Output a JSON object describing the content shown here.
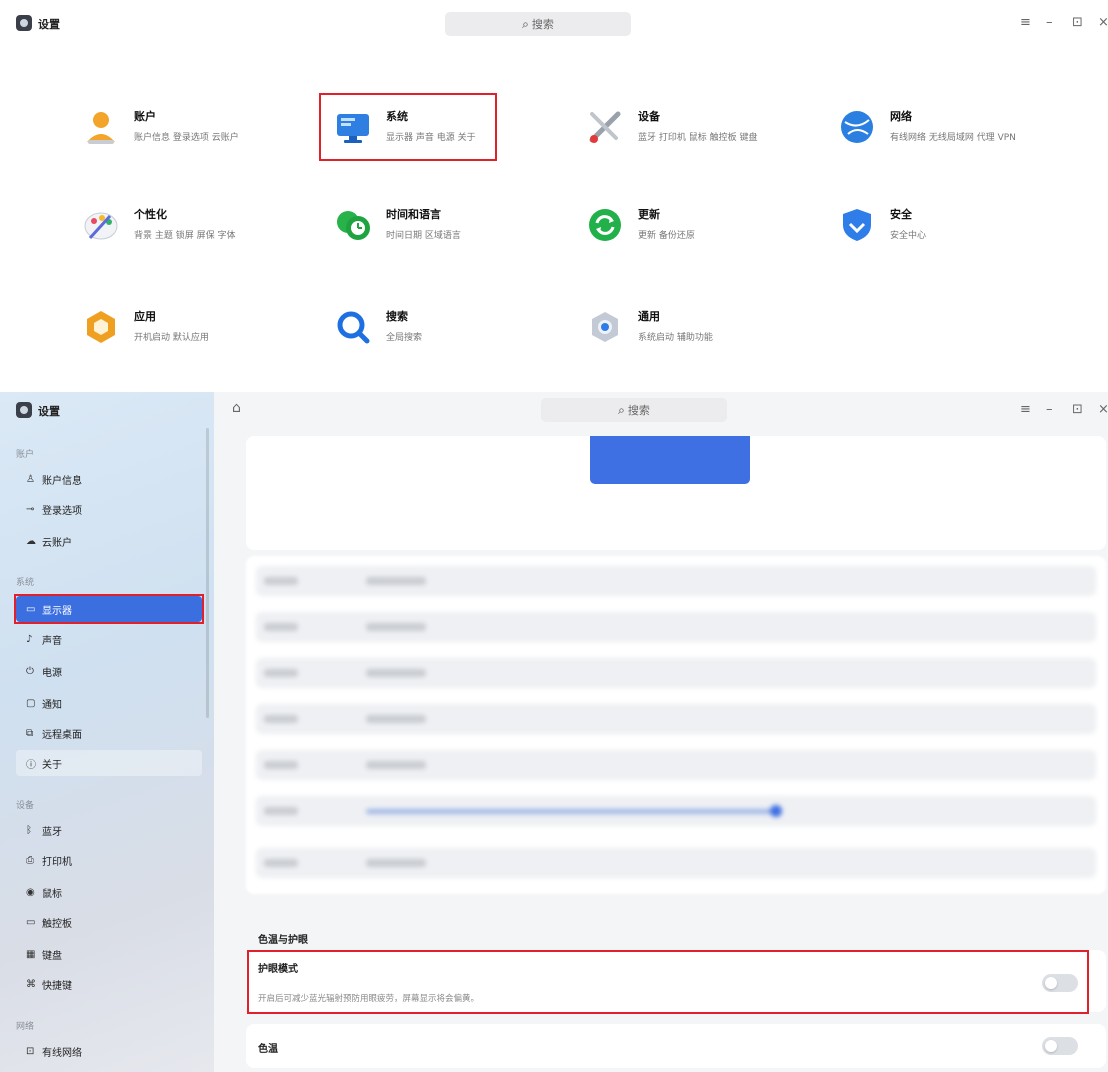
{
  "top_window": {
    "title": "设置",
    "search_placeholder": "搜索",
    "search_glyph": "⌕",
    "controls": {
      "menu": "≡",
      "minimize": "–",
      "restore": "⊡",
      "close": "×"
    },
    "tiles": [
      {
        "title": "账户",
        "subtitle": "账户信息 登录选项 云账户",
        "icon": "user-icon",
        "color": "#f2a52a"
      },
      {
        "title": "系统",
        "subtitle": "显示器 声音 电源 关于",
        "icon": "monitor-icon",
        "color": "#2f7fe2"
      },
      {
        "title": "设备",
        "subtitle": "蓝牙 打印机 鼠标 触控板 键盘",
        "icon": "tools-icon",
        "color": "#9aa1ab"
      },
      {
        "title": "网络",
        "subtitle": "有线网络 无线局域网 代理 VPN",
        "icon": "globe-icon",
        "color": "#2b7fe0"
      },
      {
        "title": "个性化",
        "subtitle": "背景 主题 锁屏 屏保 字体",
        "icon": "palette-icon",
        "color": "#5b6bd8"
      },
      {
        "title": "时间和语言",
        "subtitle": "时间日期 区域语言",
        "icon": "time-language-icon",
        "color": "#27b24a"
      },
      {
        "title": "更新",
        "subtitle": "更新 备份还原",
        "icon": "update-icon",
        "color": "#22b04a"
      },
      {
        "title": "安全",
        "subtitle": "安全中心",
        "icon": "shield-icon",
        "color": "#2e7de8"
      },
      {
        "title": "应用",
        "subtitle": "开机启动 默认应用",
        "icon": "app-icon",
        "color": "#f0a020"
      },
      {
        "title": "搜索",
        "subtitle": "全局搜索",
        "icon": "search-app-icon",
        "color": "#1e6fe0"
      },
      {
        "title": "通用",
        "subtitle": "系统启动 辅助功能",
        "icon": "general-icon",
        "color": "#9aa6b8"
      }
    ]
  },
  "bottom_window": {
    "title": "设置",
    "home_glyph": "⌂",
    "search_placeholder": "搜索",
    "search_glyph": "⌕",
    "controls": {
      "menu": "≡",
      "minimize": "–",
      "restore": "⊡",
      "close": "×"
    },
    "sidebar": {
      "groups": [
        {
          "label": "账户",
          "items": [
            {
              "label": "账户信息",
              "glyph": "♙"
            },
            {
              "label": "登录选项",
              "glyph": "⊸"
            },
            {
              "label": "云账户",
              "glyph": "☁"
            }
          ]
        },
        {
          "label": "系统",
          "items": [
            {
              "label": "显示器",
              "glyph": "▭"
            },
            {
              "label": "声音",
              "glyph": "♪"
            },
            {
              "label": "电源",
              "glyph": "⏻"
            },
            {
              "label": "通知",
              "glyph": "▢"
            },
            {
              "label": "远程桌面",
              "glyph": "⧉"
            },
            {
              "label": "关于",
              "glyph": "ⓘ"
            }
          ]
        },
        {
          "label": "设备",
          "items": [
            {
              "label": "蓝牙",
              "glyph": "ᛒ"
            },
            {
              "label": "打印机",
              "glyph": "⎙"
            },
            {
              "label": "鼠标",
              "glyph": "◉"
            },
            {
              "label": "触控板",
              "glyph": "▭"
            },
            {
              "label": "键盘",
              "glyph": "▦"
            },
            {
              "label": "快捷键",
              "glyph": "⌘"
            }
          ]
        },
        {
          "label": "网络",
          "items": [
            {
              "label": "有线网络",
              "glyph": "⊡"
            }
          ]
        }
      ]
    },
    "main": {
      "section_title": "色温与护眼",
      "eye_protection": {
        "title": "护眼模式",
        "description": "开启后可减少蓝光辐射预防用眼疲劳，屏幕显示将会偏黄。",
        "enabled": false
      },
      "color_temperature": {
        "title": "色温",
        "enabled": false
      }
    }
  },
  "colors": {
    "accent": "#3b6fe0",
    "highlight": "#e0202a"
  }
}
